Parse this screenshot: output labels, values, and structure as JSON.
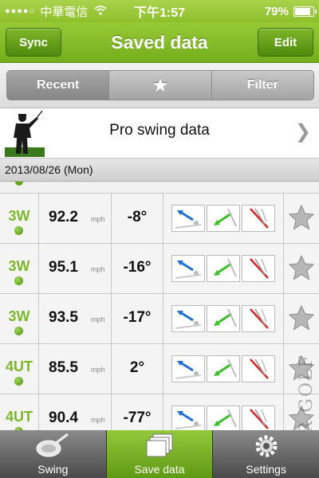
{
  "status_bar": {
    "carrier": "中華電信",
    "time": "下午1:57",
    "battery": "79%",
    "battery_level": 0.79,
    "signal_icon": "signal-dots-icon",
    "wifi_icon": "wifi-icon"
  },
  "nav": {
    "title": "Saved data",
    "left_button": "Sync",
    "right_button": "Edit"
  },
  "segments": {
    "recent": "Recent",
    "favorites_icon": "star-icon",
    "filter": "Filter"
  },
  "pro_row": {
    "label": "Pro swing data",
    "icon": "golfer-silhouette-icon"
  },
  "date_header": "2013/08/26 (Mon)",
  "speed_unit": "mph",
  "rows": [
    {
      "club": "3W",
      "speed": "92.2",
      "angle": "-8°"
    },
    {
      "club": "3W",
      "speed": "95.1",
      "angle": "-16°"
    },
    {
      "club": "3W",
      "speed": "93.5",
      "angle": "-17°"
    },
    {
      "club": "4UT",
      "speed": "85.5",
      "angle": "2°"
    },
    {
      "club": "4UT",
      "speed": "90.4",
      "angle": "-77°"
    }
  ],
  "tabs": {
    "swing": "Swing",
    "save": "Save data",
    "settings": "Settings"
  },
  "watermark": "PEAR GOLF",
  "colors": {
    "accent_green": "#7cb82a",
    "nav_green": "#86bd28"
  }
}
